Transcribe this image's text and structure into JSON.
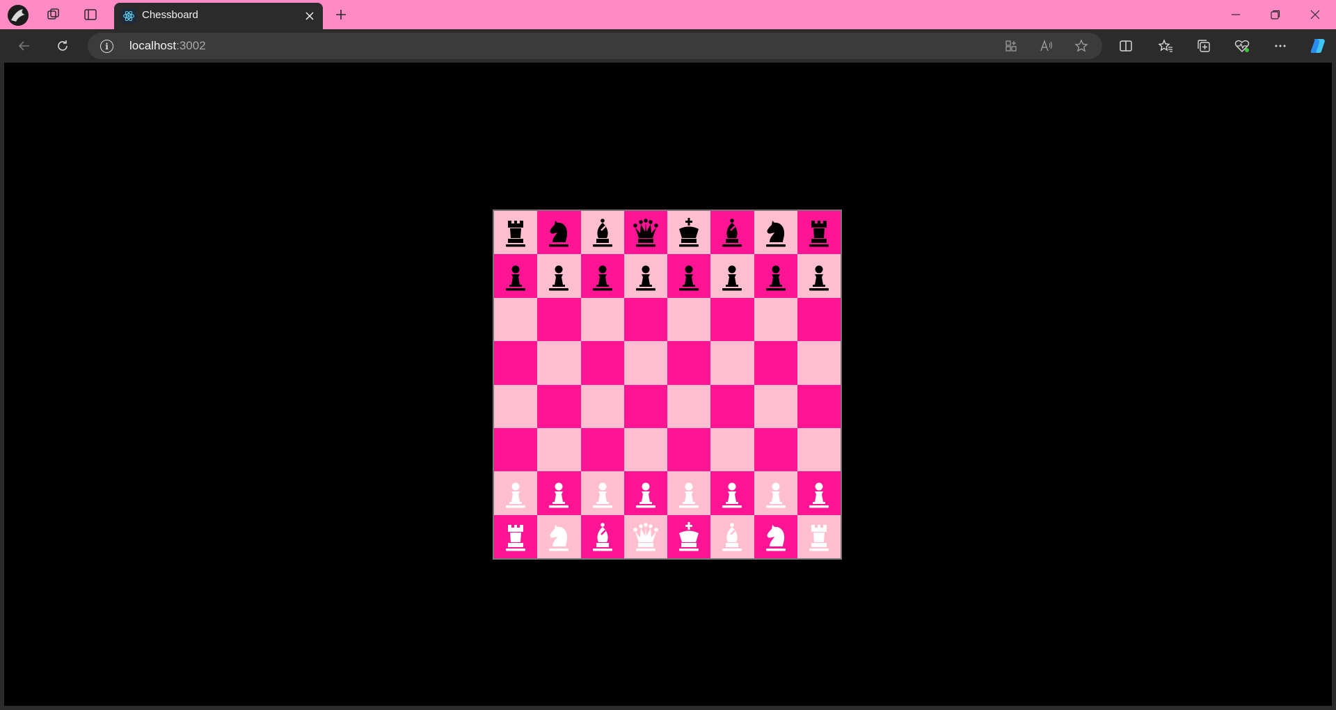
{
  "browser": {
    "tab": {
      "title": "Chessboard",
      "favicon": "react-icon"
    },
    "address": {
      "host": "localhost",
      "port": ":3002"
    },
    "colors": {
      "tabstrip": "#ff8ac4",
      "chrome": "#2b2b2b",
      "omnibox": "#3b3b3b"
    }
  },
  "board": {
    "colors": {
      "light": "#ffbfd0",
      "dark": "#ff1493",
      "white_piece": "#ffffff",
      "black_piece": "#000000"
    },
    "ranks": [
      [
        "bR",
        "bN",
        "bB",
        "bQ",
        "bK",
        "bB",
        "bN",
        "bR"
      ],
      [
        "bP",
        "bP",
        "bP",
        "bP",
        "bP",
        "bP",
        "bP",
        "bP"
      ],
      [
        "",
        "",
        "",
        "",
        "",
        "",
        "",
        ""
      ],
      [
        "",
        "",
        "",
        "",
        "",
        "",
        "",
        ""
      ],
      [
        "",
        "",
        "",
        "",
        "",
        "",
        "",
        ""
      ],
      [
        "",
        "",
        "",
        "",
        "",
        "",
        "",
        ""
      ],
      [
        "wP",
        "wP",
        "wP",
        "wP",
        "wP",
        "wP",
        "wP",
        "wP"
      ],
      [
        "wR",
        "wN",
        "wB",
        "wQ",
        "wK",
        "wB",
        "wN",
        "wR"
      ]
    ]
  }
}
